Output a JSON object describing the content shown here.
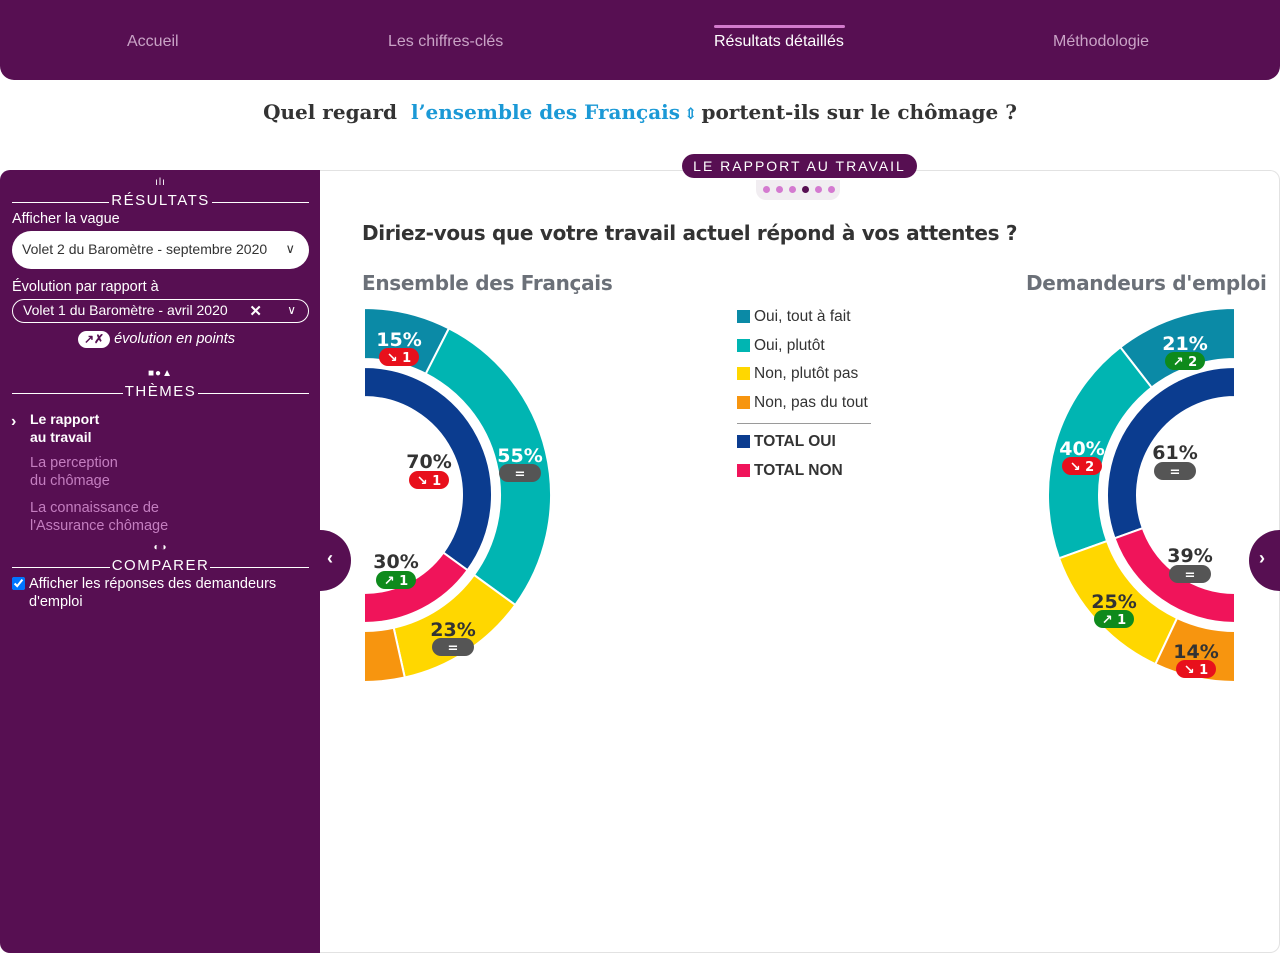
{
  "nav": {
    "items": [
      {
        "label": "Accueil",
        "active": false
      },
      {
        "label": "Les chiffres-clés",
        "active": false
      },
      {
        "label": "Résultats détaillés",
        "active": true
      },
      {
        "label": "Méthodologie",
        "active": false
      }
    ]
  },
  "question": {
    "prefix": "Quel regard",
    "population": "l’ensemble des Français",
    "suffix": "portent-ils sur le chômage ?"
  },
  "sidebar": {
    "results_title": "RÉSULTATS",
    "wave_label": "Afficher la vague",
    "wave_value": "Volet 2 du Baromètre - septembre 2020",
    "evolution_label": "Évolution par rapport à",
    "evolution_value": "Volet 1 du Baromètre - avril 2020",
    "evolution_toggle": "↗✗",
    "evolution_points_label": "évolution en points",
    "themes_title": "THÈMES",
    "themes": [
      {
        "line1": "Le rapport",
        "line2": "au travail",
        "active": true
      },
      {
        "line1": "La perception",
        "line2": "du chômage",
        "active": false
      },
      {
        "line1": "La connaissance de",
        "line2": "l'Assurance chômage",
        "active": false
      }
    ],
    "compare_title": "COMPARER",
    "compare_label": "Afficher les réponses des demandeurs d'emploi",
    "compare_checked": true
  },
  "panel": {
    "theme_pill": "LE RAPPORT AU TRAVAIL",
    "pager": {
      "count": 6,
      "active": 3
    },
    "question_title": "Diriez-vous que votre travail actuel répond à vos attentes ?",
    "left_subtitle": "Ensemble des Français",
    "right_subtitle": "Demandeurs d'emploi"
  },
  "legend": [
    {
      "label": "Oui, tout à fait",
      "color": "#0b8aa6",
      "bold": false
    },
    {
      "label": "Oui, plutôt",
      "color": "#00b5b2",
      "bold": false
    },
    {
      "label": "Non, plutôt pas",
      "color": "#ffd700",
      "bold": false
    },
    {
      "label": "Non, pas du tout",
      "color": "#f7950f",
      "bold": false
    },
    {
      "label": "TOTAL OUI",
      "color": "#0b3c8f",
      "bold": true
    },
    {
      "label": "TOTAL NON",
      "color": "#f0145a",
      "bold": true
    }
  ],
  "chart_data": [
    {
      "type": "donut",
      "title": "Ensemble des Français",
      "outer": [
        {
          "name": "Oui, tout à fait",
          "value": 15,
          "label": "15%",
          "evolution": "down",
          "delta": "1"
        },
        {
          "name": "Oui, plutôt",
          "value": 55,
          "label": "55%",
          "evolution": "stable",
          "delta": "="
        },
        {
          "name": "Non, plutôt pas",
          "value": 23,
          "label": "23%",
          "evolution": "stable",
          "delta": "="
        },
        {
          "name": "Non, pas du tout",
          "value": 7,
          "label": "",
          "evolution": "none",
          "delta": ""
        }
      ],
      "inner": [
        {
          "name": "TOTAL OUI",
          "value": 70,
          "label": "70%",
          "evolution": "down",
          "delta": "1"
        },
        {
          "name": "TOTAL NON",
          "value": 30,
          "label": "30%",
          "evolution": "up",
          "delta": "1"
        }
      ]
    },
    {
      "type": "donut",
      "title": "Demandeurs d'emploi",
      "outer": [
        {
          "name": "Oui, tout à fait",
          "value": 21,
          "label": "21%",
          "evolution": "up",
          "delta": "2"
        },
        {
          "name": "Oui, plutôt",
          "value": 40,
          "label": "40%",
          "evolution": "down",
          "delta": "2"
        },
        {
          "name": "Non, plutôt pas",
          "value": 25,
          "label": "25%",
          "evolution": "up",
          "delta": "1"
        },
        {
          "name": "Non, pas du tout",
          "value": 14,
          "label": "14%",
          "evolution": "down",
          "delta": "1"
        }
      ],
      "inner": [
        {
          "name": "TOTAL OUI",
          "value": 61,
          "label": "61%",
          "evolution": "stable",
          "delta": "="
        },
        {
          "name": "TOTAL NON",
          "value": 39,
          "label": "39%",
          "evolution": "stable",
          "delta": "="
        }
      ]
    }
  ],
  "badge_colors": {
    "down": "#e8101c",
    "up": "#0e8a1c",
    "stable": "#555555"
  },
  "badge_arrows": {
    "down": "↘",
    "up": "↗"
  },
  "arrows": {
    "prev": "‹",
    "next": "›"
  }
}
